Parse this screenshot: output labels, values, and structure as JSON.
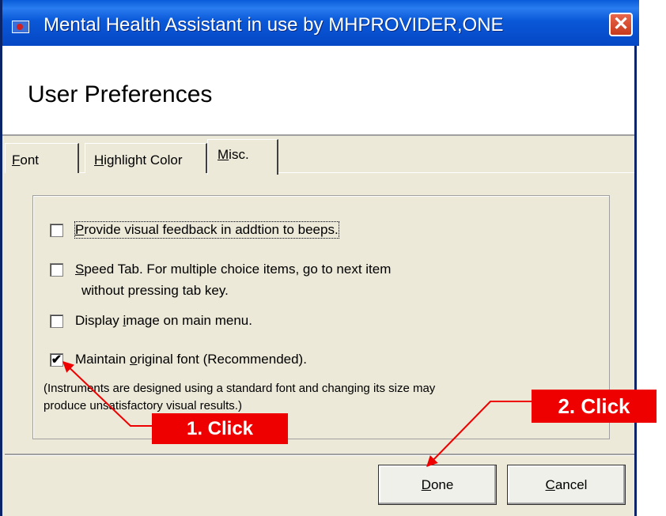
{
  "window": {
    "title": "Mental Health Assistant in use by MHPROVIDER,ONE",
    "close_label": "✕"
  },
  "header": {
    "title": "User Preferences"
  },
  "tabs": [
    {
      "label_prefix": "",
      "mnemonic": "F",
      "label_rest": "ont",
      "active": false
    },
    {
      "label_prefix": "",
      "mnemonic": "H",
      "label_rest": "ighlight Color",
      "active": false
    },
    {
      "label_prefix": "",
      "mnemonic": "M",
      "label_rest": "isc.",
      "active": true
    }
  ],
  "options": [
    {
      "prefix": "",
      "mnemonic": "P",
      "rest": "rovide visual feedback in addtion to beeps.",
      "checked": false
    },
    {
      "prefix": "",
      "mnemonic": "S",
      "rest": "peed Tab. For multiple choice items, go to next item",
      "line2": "without pressing tab key.",
      "checked": false
    },
    {
      "prefix": "Display ",
      "mnemonic": "i",
      "rest": "mage on main menu.",
      "checked": false
    },
    {
      "prefix": "Maintain ",
      "mnemonic": "o",
      "rest": "riginal font (Recommended).",
      "checked": true
    }
  ],
  "note": {
    "line1": "(Instruments are designed using a standard font and changing its size may",
    "line2": "produce unsatisfactory visual results.)"
  },
  "buttons": {
    "done": {
      "mnemonic": "D",
      "rest": "one"
    },
    "cancel": {
      "mnemonic": "C",
      "rest": "ancel"
    }
  },
  "callouts": {
    "step1": "1. Click",
    "step2": "2. Click",
    "color": "#ee0000"
  }
}
